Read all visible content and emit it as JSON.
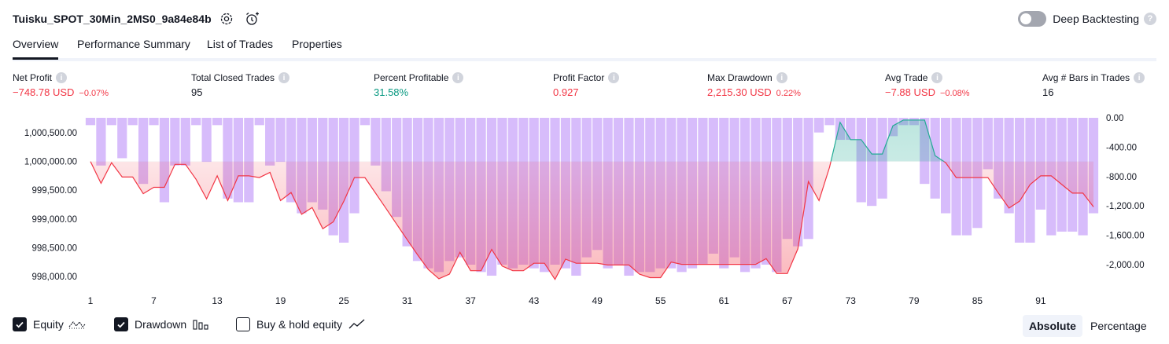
{
  "header": {
    "title": "Tuisku_SPOT_30Min_2MS0_9a84e84b",
    "deep_backtesting_label": "Deep Backtesting",
    "deep_backtesting_on": false,
    "settings_icon": "gear-icon",
    "alert_icon": "alarm-clock-plus-icon"
  },
  "tabs": [
    {
      "label": "Overview",
      "active": true
    },
    {
      "label": "Performance Summary",
      "active": false
    },
    {
      "label": "List of Trades",
      "active": false
    },
    {
      "label": "Properties",
      "active": false
    }
  ],
  "stats": {
    "net_profit": {
      "label": "Net Profit",
      "value": "−748.78 USD",
      "pct": "−0.07%"
    },
    "total_closed_trades": {
      "label": "Total Closed Trades",
      "value": "95"
    },
    "percent_profitable": {
      "label": "Percent Profitable",
      "value": "31.58%"
    },
    "profit_factor": {
      "label": "Profit Factor",
      "value": "0.927"
    },
    "max_drawdown": {
      "label": "Max Drawdown",
      "value": "2,215.30 USD",
      "pct": "0.22%"
    },
    "avg_trade": {
      "label": "Avg Trade",
      "value": "−7.88 USD",
      "pct": "−0.08%"
    },
    "avg_bars": {
      "label": "Avg # Bars in Trades",
      "value": "16"
    }
  },
  "chart_data": {
    "type": "line",
    "left_axis": {
      "ticks": [
        "1,000,500.00",
        "1,000,000.00",
        "999,500.00",
        "999,000.00",
        "998,500.00",
        "998,000.00"
      ],
      "ylim": [
        997800,
        1000800
      ]
    },
    "right_axis": {
      "ticks": [
        "0.00",
        "-400.00",
        "-800.00",
        "-1,200.00",
        "-1,600.00",
        "-2,000.00"
      ],
      "ylim": [
        -2250,
        0
      ]
    },
    "x_ticks": [
      "1",
      "7",
      "13",
      "19",
      "25",
      "31",
      "37",
      "43",
      "49",
      "55",
      "61",
      "67",
      "73",
      "79",
      "85",
      "91"
    ],
    "x_range": [
      1,
      96
    ],
    "baseline": 1000000,
    "series": [
      {
        "name": "Equity",
        "color_loss": "#f23645",
        "color_gain": "#22ab94",
        "values": [
          1000000,
          999620,
          999980,
          999730,
          999730,
          999440,
          999550,
          999550,
          999950,
          999950,
          999690,
          999350,
          999750,
          999320,
          999750,
          999750,
          999720,
          999810,
          999320,
          999460,
          999080,
          999200,
          998830,
          998950,
          999310,
          999720,
          999720,
          999450,
          999180,
          998910,
          998640,
          998370,
          998120,
          997960,
          998040,
          998420,
          998100,
          998100,
          998470,
          998180,
          998100,
          998100,
          998230,
          998230,
          997950,
          998300,
          998230,
          998230,
          998230,
          998200,
          998200,
          998200,
          998040,
          997980,
          997980,
          998250,
          998210,
          998210,
          998210,
          998210,
          998210,
          998210,
          998210,
          998210,
          998310,
          998050,
          998050,
          998480,
          999650,
          999320,
          999900,
          1000680,
          1000380,
          1000380,
          1000130,
          1000130,
          1000620,
          1000720,
          1000720,
          1000720,
          1000100,
          999980,
          999720,
          999720,
          999720,
          999720,
          999450,
          999190,
          999310,
          999600,
          999750,
          999750,
          999600,
          999450,
          999450,
          999210
        ]
      },
      {
        "name": "Drawdown",
        "color": "#c9a5fa",
        "values": [
          -100,
          -650,
          -100,
          -550,
          -100,
          -900,
          -100,
          -1150,
          -650,
          -650,
          -100,
          -600,
          -100,
          -1100,
          -1150,
          -1150,
          -100,
          -650,
          -600,
          -1150,
          -1300,
          -1150,
          -1250,
          -1600,
          -1700,
          -1300,
          -100,
          -650,
          -1000,
          -1350,
          -1750,
          -1950,
          -2050,
          -2100,
          -1950,
          -1900,
          -2000,
          -2100,
          -2150,
          -2000,
          -2050,
          -2000,
          -2050,
          -2100,
          -2000,
          -2050,
          -2150,
          -1900,
          -1800,
          -2050,
          -2000,
          -2150,
          -2100,
          -2100,
          -2050,
          -2050,
          -2100,
          -2050,
          -2000,
          -1850,
          -2050,
          -1900,
          -2100,
          -2050,
          -2000,
          -2100,
          -1650,
          -1750,
          -1650,
          -200,
          -100,
          -300,
          -300,
          -1150,
          -1200,
          -1100,
          -250,
          -100,
          -100,
          -900,
          -1100,
          -1300,
          -1600,
          -1600,
          -1500,
          -700,
          -1100,
          -1300,
          -1700,
          -1700,
          -1250,
          -1600,
          -1550,
          -1550,
          -1600,
          -1300
        ]
      },
      {
        "name": "Buy & hold equity",
        "visible": false
      }
    ]
  },
  "legend": {
    "items": [
      {
        "label": "Equity",
        "checked": true,
        "icon": "equity-line-icon"
      },
      {
        "label": "Drawdown",
        "checked": true,
        "icon": "drawdown-bars-icon"
      },
      {
        "label": "Buy & hold equity",
        "checked": false,
        "icon": "buy-hold-line-icon"
      }
    ],
    "modes": [
      {
        "label": "Absolute",
        "active": true
      },
      {
        "label": "Percentage",
        "active": false
      }
    ]
  },
  "colors": {
    "loss": "#f23645",
    "gain": "#089981",
    "drawdown": "#c9a5fa",
    "text": "#131722",
    "muted": "#d1d4dc"
  }
}
